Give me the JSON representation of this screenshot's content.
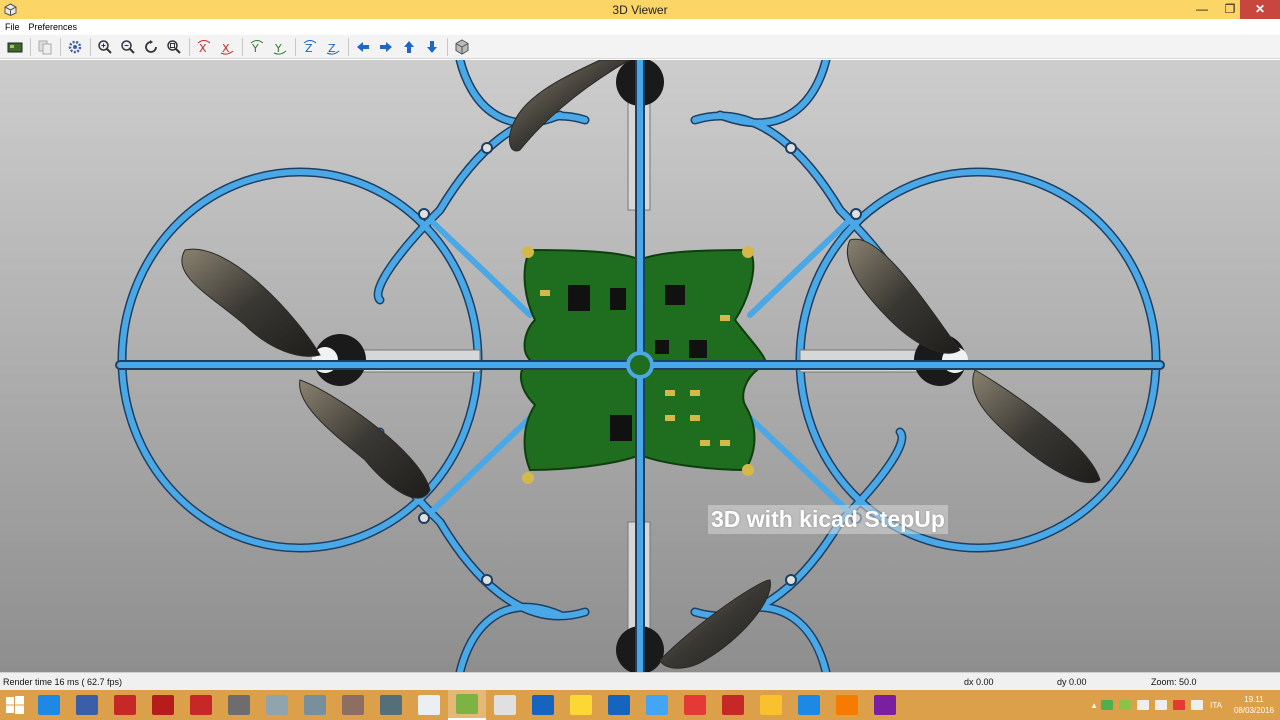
{
  "window": {
    "title": "3D Viewer"
  },
  "menu": [
    {
      "label": "File"
    },
    {
      "label": "Preferences"
    }
  ],
  "toolbar": {
    "buttons": [
      {
        "name": "render-icon"
      },
      {
        "name": "copy-icon"
      },
      {
        "name": "settings-icon"
      },
      {
        "name": "zoom-in-icon"
      },
      {
        "name": "zoom-out-icon"
      },
      {
        "name": "redraw-icon"
      },
      {
        "name": "zoom-fit-icon"
      },
      {
        "name": "rotate-x-cw-icon"
      },
      {
        "name": "rotate-x-ccw-icon"
      },
      {
        "name": "rotate-y-cw-icon"
      },
      {
        "name": "rotate-y-ccw-icon"
      },
      {
        "name": "rotate-z-cw-icon"
      },
      {
        "name": "rotate-z-ccw-icon"
      },
      {
        "name": "move-left-icon"
      },
      {
        "name": "move-right-icon"
      },
      {
        "name": "move-up-icon"
      },
      {
        "name": "move-down-icon"
      },
      {
        "name": "ortho-cube-icon"
      }
    ]
  },
  "viewport": {
    "overlay_text": "3D with kicad StepUp"
  },
  "status": {
    "render_time": "Render time 16 ms ( 62.7 fps)",
    "dx": "dx 0.00",
    "dy": "dy 0.00",
    "zoom": "Zoom: 50.0"
  },
  "taskbar": {
    "apps": [
      {
        "name": "internet-explorer-icon",
        "color": "#1e88e5"
      },
      {
        "name": "pc-icon",
        "color": "#3b5ea8"
      },
      {
        "name": "red-app-icon",
        "color": "#c62828"
      },
      {
        "name": "pdf-app-icon",
        "color": "#b71c1c"
      },
      {
        "name": "filezilla-icon",
        "color": "#c62828"
      },
      {
        "name": "tool-icon",
        "color": "#6d6d6d"
      },
      {
        "name": "notepad-icon",
        "color": "#90a4ae"
      },
      {
        "name": "keyboard-icon",
        "color": "#78909c"
      },
      {
        "name": "doc-icon",
        "color": "#8d6e63"
      },
      {
        "name": "gerber-icon",
        "color": "#546e7a"
      },
      {
        "name": "paper-plane-icon",
        "color": "#eceff1"
      },
      {
        "name": "pcbnew-icon",
        "color": "#7cb342",
        "active": true
      },
      {
        "name": "eeschema-icon",
        "color": "#e0e0e0"
      },
      {
        "name": "firefox-icon",
        "color": "#1565c0"
      },
      {
        "name": "folder-icon",
        "color": "#fdd835"
      },
      {
        "name": "settings-app-icon",
        "color": "#1565c0"
      },
      {
        "name": "blue-doc-icon",
        "color": "#42a5f5"
      },
      {
        "name": "freecad-icon",
        "color": "#e53935"
      },
      {
        "name": "acrobat-icon",
        "color": "#c62828"
      },
      {
        "name": "puzzle-icon",
        "color": "#fbc02d"
      },
      {
        "name": "cube-app-icon",
        "color": "#1e88e5"
      },
      {
        "name": "blender-icon",
        "color": "#f57c00"
      },
      {
        "name": "matlab-icon",
        "color": "#7b1fa2"
      }
    ],
    "tray": {
      "language": "ITA",
      "time": "19.11",
      "date": "08/03/2016"
    }
  }
}
